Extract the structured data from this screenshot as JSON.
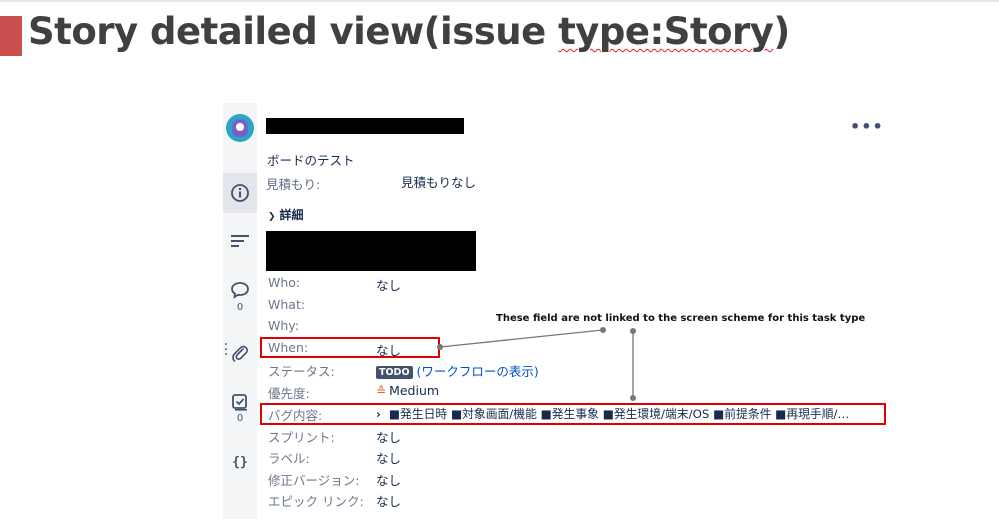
{
  "slide": {
    "title_prefix": "Story detailed view(issue ",
    "title_squiggle": "type:Story",
    "title_suffix": ")"
  },
  "annotation": "These field are not linked to the screen scheme for this task type",
  "issue": {
    "board": "ボードのテスト",
    "estimate_label": "見積もり:",
    "estimate_value": "見積もりなし",
    "details_label": "詳細",
    "more_icon": "•••"
  },
  "sidebar": {
    "comments_count": "0",
    "checklist_count": "0",
    "code_icon": "{}"
  },
  "fields": [
    {
      "label": "Who:",
      "value": "なし"
    },
    {
      "label": "What:",
      "value": ""
    },
    {
      "label": "Why:",
      "value": ""
    },
    {
      "label": "When:",
      "value": "なし"
    },
    {
      "label": "ステータス:",
      "value": ""
    },
    {
      "label": "優先度:",
      "value": ""
    },
    {
      "label": "バグ内容:",
      "value": "■発生日時 ■対象画面/機能 ■発生事象 ■発生環境/端末/OS ■前提条件 ■再現手順/…"
    },
    {
      "label": "スプリント:",
      "value": "なし"
    },
    {
      "label": "ラベル:",
      "value": "なし"
    },
    {
      "label": "修正バージョン:",
      "value": "なし"
    },
    {
      "label": "エピック リンク:",
      "value": "なし"
    }
  ],
  "status": {
    "badge": "TODO",
    "workflow_link": "(ワークフローの表示)"
  },
  "priority": {
    "value": "Medium"
  },
  "colors": {
    "accent_red": "#e00000",
    "title_bar": "#c9504f",
    "todo_badge": "#42526e",
    "link": "#0052cc",
    "priority_medium": "#ff5630"
  }
}
